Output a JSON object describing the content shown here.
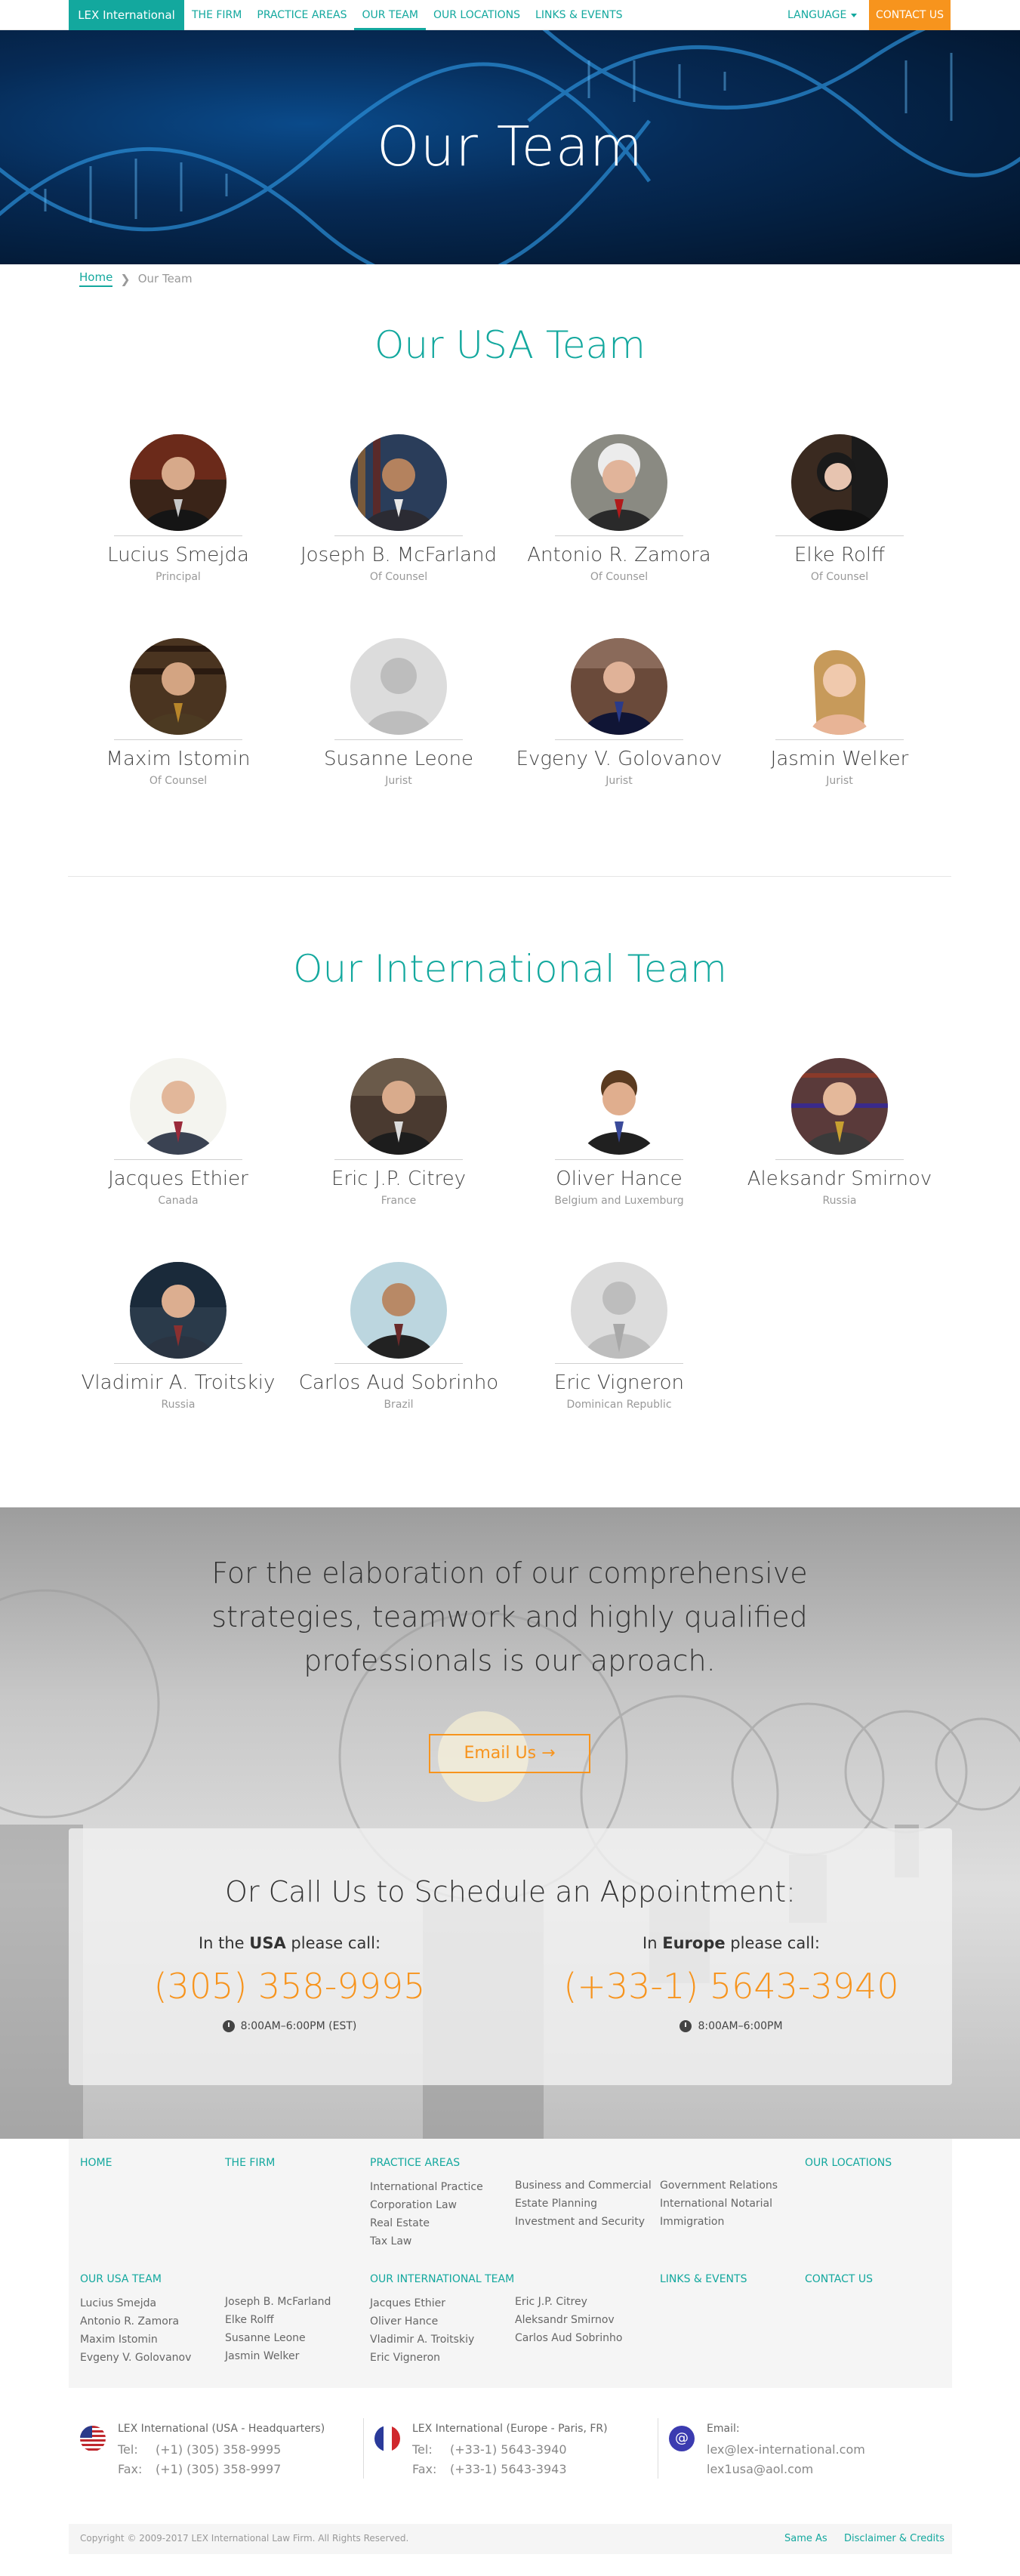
{
  "nav": {
    "brand": "LEX International",
    "links": [
      "THE FIRM",
      "PRACTICE AREAS",
      "OUR TEAM",
      "OUR LOCATIONS",
      "LINKS & EVENTS"
    ],
    "language": "LANGUAGE",
    "contact": "CONTACT US"
  },
  "hero": {
    "title": "Our Team"
  },
  "breadcrumb": {
    "home": "Home",
    "current": "Our Team"
  },
  "usa": {
    "title": "Our USA Team",
    "members": [
      {
        "name": "Lucius Smejda",
        "role": "Principal"
      },
      {
        "name": "Joseph B. McFarland",
        "role": "Of Counsel"
      },
      {
        "name": "Antonio R. Zamora",
        "role": "Of Counsel"
      },
      {
        "name": "Elke Rolff",
        "role": "Of Counsel"
      },
      {
        "name": "Maxim Istomin",
        "role": "Of Counsel"
      },
      {
        "name": "Susanne Leone",
        "role": "Jurist"
      },
      {
        "name": "Evgeny V. Golovanov",
        "role": "Jurist"
      },
      {
        "name": "Jasmin Welker",
        "role": "Jurist"
      }
    ]
  },
  "intl": {
    "title": "Our International Team",
    "members": [
      {
        "name": "Jacques Ethier",
        "role": "Canada"
      },
      {
        "name": "Eric J.P. Citrey",
        "role": "France"
      },
      {
        "name": "Oliver Hance",
        "role": "Belgium and Luxemburg"
      },
      {
        "name": "Aleksandr Smirnov",
        "role": "Russia"
      },
      {
        "name": "Vladimir A. Troitskiy",
        "role": "Russia"
      },
      {
        "name": "Carlos Aud Sobrinho",
        "role": "Brazil"
      },
      {
        "name": "Eric Vigneron",
        "role": "Dominican Republic"
      }
    ]
  },
  "cta": {
    "text": "For the elaboration of our comprehensive strategies, teamwork and highly qualified professionals is our aproach.",
    "email_button": "Email Us",
    "panel_title": "Or Call Us to Schedule an Appointment:",
    "usa": {
      "pre": "In the",
      "region": "USA",
      "post": "please call:",
      "number": "(305) 358-9995",
      "hours": "8:00AM–6:00PM (EST)"
    },
    "europe": {
      "pre": "In",
      "region": "Europe",
      "post": "please call:",
      "number": "(+33-1) 5643-3940",
      "hours": "8:00AM–6:00PM"
    }
  },
  "footer": {
    "home": "HOME",
    "firm": "THE FIRM",
    "practice": "PRACTICE AREAS",
    "practice_col1": [
      "International Practice",
      "Corporation Law",
      "Real Estate",
      "Tax Law"
    ],
    "practice_col2": [
      "Business and Commercial",
      "Estate Planning",
      "Investment and Security"
    ],
    "practice_col3": [
      "Government Relations",
      "International Notarial",
      "Immigration"
    ],
    "locations": "OUR LOCATIONS",
    "usa_team": "OUR USA TEAM",
    "usa_col1": [
      "Lucius Smejda",
      "Antonio R. Zamora",
      "Maxim Istomin",
      "Evgeny V. Golovanov"
    ],
    "usa_col2": [
      "Joseph B. McFarland",
      "Elke Rolff",
      "Susanne Leone",
      "Jasmin Welker"
    ],
    "intl_team": "OUR INTERNATIONAL TEAM",
    "intl_col1": [
      "Jacques Ethier",
      "Oliver Hance",
      "Vladimir A. Troitskiy",
      "Eric Vigneron"
    ],
    "intl_col2": [
      "Eric J.P. Citrey",
      "Aleksandr Smirnov",
      "Carlos Aud Sobrinho"
    ],
    "links": "LINKS & EVENTS",
    "contact": "CONTACT US"
  },
  "contacts": {
    "usa": {
      "title": "LEX International (USA - Headquarters)",
      "tel_label": "Tel:",
      "tel": "(+1) (305) 358-9995",
      "fax_label": "Fax:",
      "fax": "(+1) (305) 358-9997"
    },
    "eu": {
      "title": "LEX International (Europe - Paris, FR)",
      "tel_label": "Tel:",
      "tel": "(+33-1) 5643-3940",
      "fax_label": "Fax:",
      "fax": "(+33-1) 5643-3943"
    },
    "email": {
      "title": "Email:",
      "email1": "lex@lex-international.com",
      "email2": "lex1usa@aol.com"
    }
  },
  "bottom": {
    "copyright": "Copyright © 2009-2017 LEX International Law Firm. All Rights Reserved.",
    "same_as": "Same As",
    "disclaimer": "Disclaimer & Credits"
  },
  "colors": {
    "accent": "#13a89e",
    "orange": "#f7941d"
  }
}
